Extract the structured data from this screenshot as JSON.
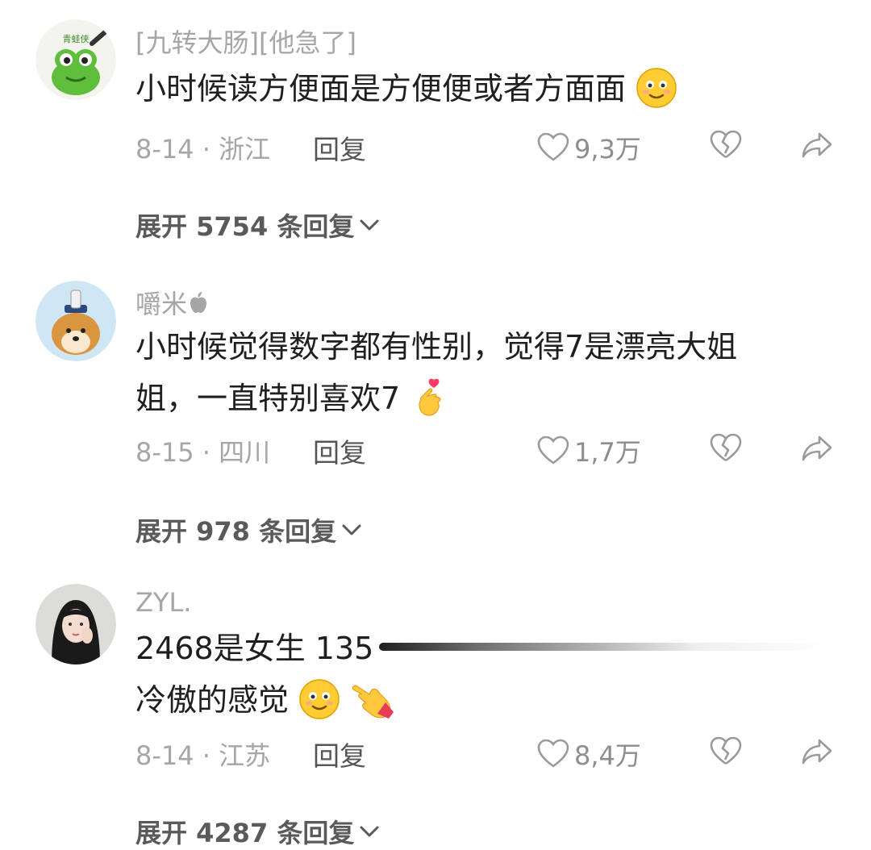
{
  "comments": [
    {
      "username": "[九转大肠][他急了]",
      "avatar": "frog-avatar",
      "avatar_text": "青蛙侠",
      "text_lines": [
        "小时候读方便面是方便便或者方面面"
      ],
      "emoji": "smiling-face-emoji",
      "date_location": "8-14 · 浙江",
      "reply_label": "回复",
      "likes": "9,3万",
      "expand_label": "展开 5754 条回复"
    },
    {
      "username": "嚼米",
      "username_badge": "apple-icon",
      "avatar": "shiba-dog-avatar",
      "text_lines": [
        "小时候觉得数字都有性别，觉得7是漂亮大姐",
        "姐，一直特别喜欢7"
      ],
      "emoji": "finger-heart-emoji",
      "date_location": "8-15 · 四川",
      "reply_label": "回复",
      "likes": "1,7万",
      "expand_label": "展开 978 条回复"
    },
    {
      "username": "ZYL.",
      "avatar": "girl-photo-avatar",
      "text_lines": [
        "2468是女生 135",
        "冷傲的感觉"
      ],
      "emoji": "smiling-face-emoji",
      "emoji2": "pointing-hand-emoji",
      "date_location": "8-14 · 江苏",
      "reply_label": "回复",
      "likes": "8,4万",
      "expand_label": "展开 4287 条回复"
    }
  ],
  "colors": {
    "text": "#1f1f1f",
    "muted": "#a6a6a6",
    "icon": "#9a9a9a",
    "background": "#ffffff"
  }
}
